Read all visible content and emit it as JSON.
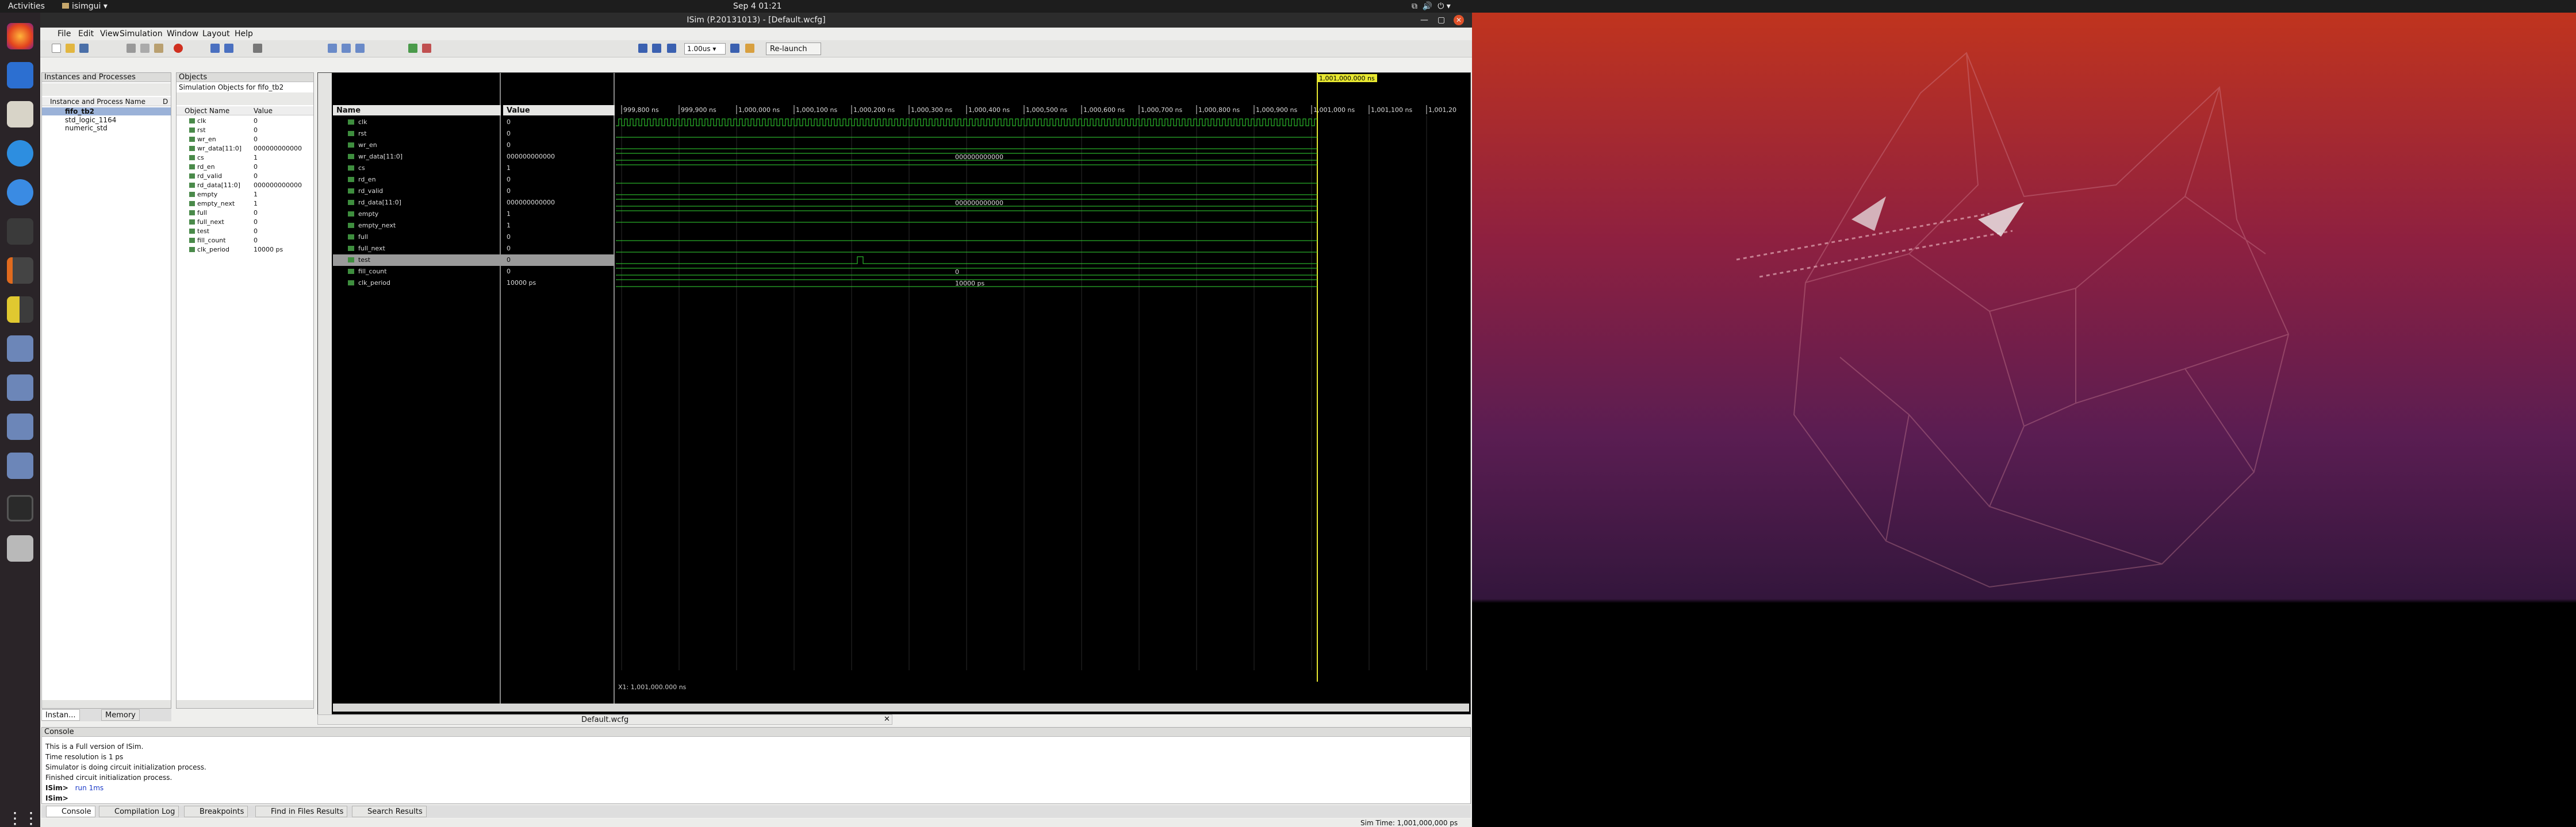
{
  "topbar": {
    "activities": "Activities",
    "app": "isimgui",
    "clock": "Sep 4  01:21"
  },
  "window": {
    "title": "ISim (P.20131013) - [Default.wcfg]",
    "menu": [
      "File",
      "Edit",
      "View",
      "Simulation",
      "Window",
      "Layout",
      "Help"
    ],
    "run_time": "1.00us",
    "relaunch": "Re-launch"
  },
  "instances": {
    "panel_title": "Instances and Processes",
    "column": "Instance and Process Name",
    "column2": "D",
    "items": [
      "fifo_tb2",
      "std_logic_1164",
      "numeric_std"
    ]
  },
  "objects": {
    "panel_title": "Objects",
    "subtitle": "Simulation Objects for fifo_tb2",
    "col_name": "Object Name",
    "col_value": "Value",
    "rows": [
      {
        "name": "clk",
        "value": "0"
      },
      {
        "name": "rst",
        "value": "0"
      },
      {
        "name": "wr_en",
        "value": "0"
      },
      {
        "name": "wr_data[11:0]",
        "value": "000000000000"
      },
      {
        "name": "cs",
        "value": "1"
      },
      {
        "name": "rd_en",
        "value": "0"
      },
      {
        "name": "rd_valid",
        "value": "0"
      },
      {
        "name": "rd_data[11:0]",
        "value": "000000000000"
      },
      {
        "name": "empty",
        "value": "1"
      },
      {
        "name": "empty_next",
        "value": "1"
      },
      {
        "name": "full",
        "value": "0"
      },
      {
        "name": "full_next",
        "value": "0"
      },
      {
        "name": "test",
        "value": "0"
      },
      {
        "name": "fill_count",
        "value": "0"
      },
      {
        "name": "clk_period",
        "value": "10000 ps"
      }
    ]
  },
  "wave": {
    "col_name": "Name",
    "col_value": "Value",
    "signals": [
      {
        "name": "clk",
        "value": "0"
      },
      {
        "name": "rst",
        "value": "0"
      },
      {
        "name": "wr_en",
        "value": "0"
      },
      {
        "name": "wr_data[11:0]",
        "value": "000000000000"
      },
      {
        "name": "cs",
        "value": "1"
      },
      {
        "name": "rd_en",
        "value": "0"
      },
      {
        "name": "rd_valid",
        "value": "0"
      },
      {
        "name": "rd_data[11:0]",
        "value": "000000000000"
      },
      {
        "name": "empty",
        "value": "1"
      },
      {
        "name": "empty_next",
        "value": "1"
      },
      {
        "name": "full",
        "value": "0"
      },
      {
        "name": "full_next",
        "value": "0"
      },
      {
        "name": "test",
        "value": "0"
      },
      {
        "name": "fill_count",
        "value": "0"
      },
      {
        "name": "clk_period",
        "value": "10000 ps"
      }
    ],
    "ticks": [
      "999,800 ns",
      "999,900 ns",
      "1,000,000 ns",
      "1,000,100 ns",
      "1,000,200 ns",
      "1,000,300 ns",
      "1,000,400 ns",
      "1,000,500 ns",
      "1,000,600 ns",
      "1,000,700 ns",
      "1,000,800 ns",
      "1,000,900 ns",
      "1,001,000 ns",
      "1,001,100 ns",
      "1,001,20"
    ],
    "cursor_label": "1,001,000.000 ns",
    "bus_wr_label": "000000000000",
    "bus_rd_label": "000000000000",
    "fill_label": "0",
    "clkp_label": "10000 ps",
    "cursor_readout": "X1: 1,001,000.000 ns",
    "file_tab": "Default.wcfg"
  },
  "left_tabs": [
    "Instan...",
    "Memory"
  ],
  "console": {
    "title": "Console",
    "lines": [
      "This is a Full version of ISim.",
      "Time resolution is 1 ps",
      "Simulator is doing circuit initialization process.",
      "Finished circuit initialization process."
    ],
    "prompt1": "ISim>",
    "cmd": "run 1ms",
    "prompt2": "ISim>"
  },
  "bottom_tabs": [
    "Console",
    "Compilation Log",
    "Breakpoints",
    "Find in Files Results",
    "Search Results"
  ],
  "status": {
    "sim_time": "Sim Time: 1,001,000,000 ps"
  }
}
